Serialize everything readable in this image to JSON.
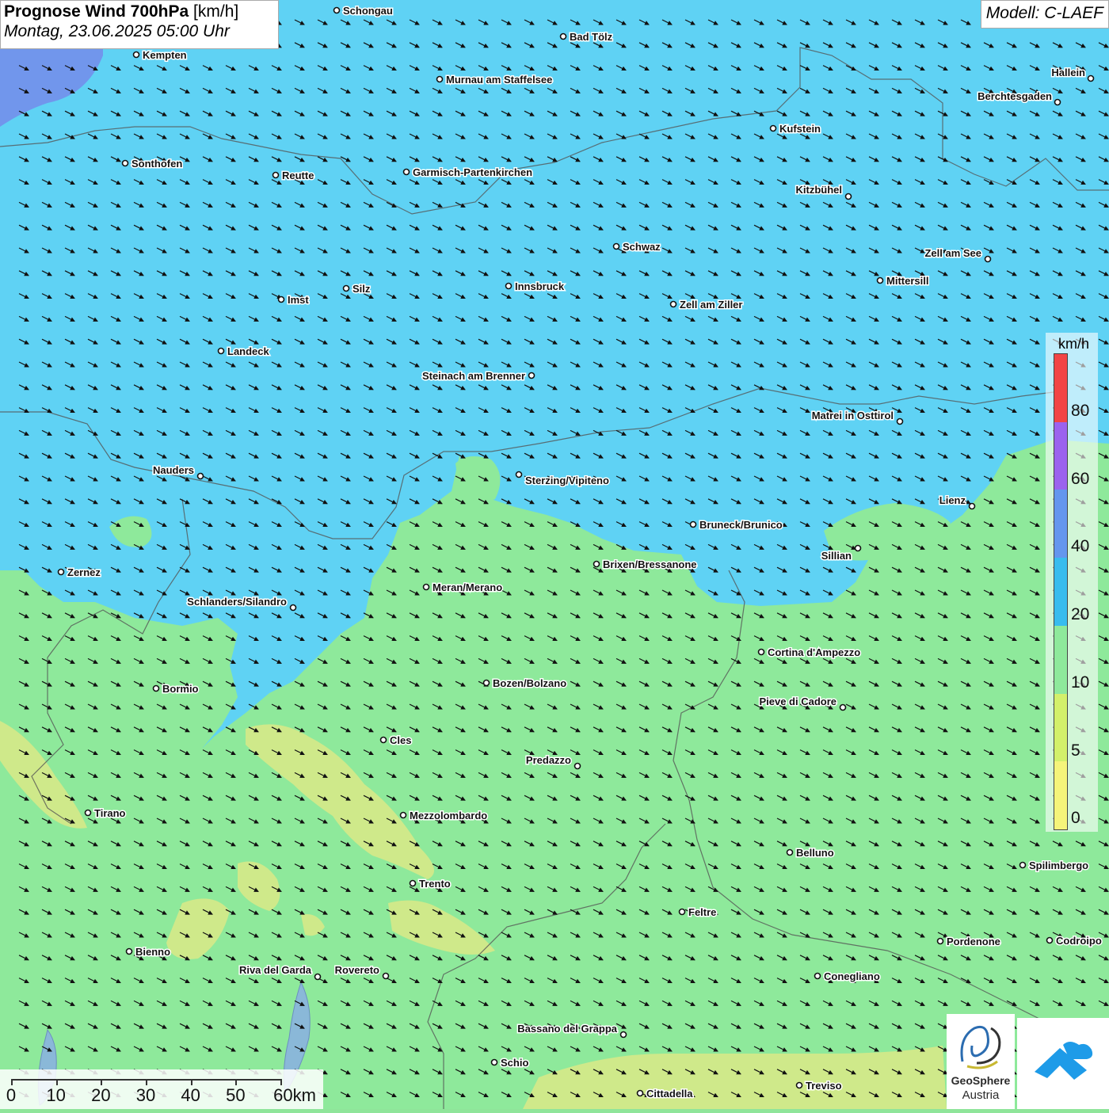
{
  "header": {
    "title_bold": "Prognose Wind 700hPa",
    "title_unit": "[km/h]",
    "datetime": "Montag, 23.06.2025 05:00 Uhr",
    "model": "Modell: C-LAEF"
  },
  "legend": {
    "unit": "km/h",
    "ticks": [
      "80",
      "60",
      "40",
      "20",
      "10",
      "5",
      "0"
    ],
    "colors": [
      "#f24545",
      "#9b62ee",
      "#6496ee",
      "#38bcee",
      "#8ee99b",
      "#d3f06a",
      "#f5f47a"
    ]
  },
  "scalebar": {
    "labels": [
      "0",
      "10",
      "20",
      "30",
      "40",
      "50",
      "60km"
    ]
  },
  "logos": {
    "geosphere_name": "GeoSphere",
    "geosphere_country": "Austria"
  },
  "colors": {
    "wind_10_20": "#8ee99b",
    "wind_20_40": "#5fd2f4",
    "wind_40_60": "#7196ec",
    "wind_5_10": "#cfe98a",
    "border": "#555555",
    "lake": "#8ab8d8",
    "arrow": "#111111"
  },
  "map": {
    "arrow_direction": "south-east",
    "cities": [
      {
        "name": "Schongau"
      },
      {
        "name": "Bad Tölz"
      },
      {
        "name": "Kempten"
      },
      {
        "name": "Murnau am Staffelsee"
      },
      {
        "name": "Hallein"
      },
      {
        "name": "Berchtesgaden"
      },
      {
        "name": "Kufstein"
      },
      {
        "name": "Sonthofen"
      },
      {
        "name": "Reutte"
      },
      {
        "name": "Garmisch-Partenkirchen"
      },
      {
        "name": "Kitzbühel"
      },
      {
        "name": "Schwaz"
      },
      {
        "name": "Zell am See"
      },
      {
        "name": "Innsbruck"
      },
      {
        "name": "Mittersill"
      },
      {
        "name": "Silz"
      },
      {
        "name": "Imst"
      },
      {
        "name": "Zell am Ziller"
      },
      {
        "name": "Landeck"
      },
      {
        "name": "Steinach am Brenner"
      },
      {
        "name": "Matrei in Osttirol"
      },
      {
        "name": "Nauders"
      },
      {
        "name": "Sterzing/Vipiteno"
      },
      {
        "name": "Lienz"
      },
      {
        "name": "Bruneck/Brunico"
      },
      {
        "name": "Sillian"
      },
      {
        "name": "Brixen/Bressanone"
      },
      {
        "name": "Zernez"
      },
      {
        "name": "Meran/Merano"
      },
      {
        "name": "Schlanders/Silandro"
      },
      {
        "name": "Cortina d'Ampezzo"
      },
      {
        "name": "Bozen/Bolzano"
      },
      {
        "name": "Bormio"
      },
      {
        "name": "Pieve di Cadore"
      },
      {
        "name": "Cles"
      },
      {
        "name": "Predazzo"
      },
      {
        "name": "Tirano"
      },
      {
        "name": "Mezzolombardo"
      },
      {
        "name": "Belluno"
      },
      {
        "name": "Spilimbergo"
      },
      {
        "name": "Trento"
      },
      {
        "name": "Feltre"
      },
      {
        "name": "Bienno"
      },
      {
        "name": "Pordenone"
      },
      {
        "name": "Codroipo"
      },
      {
        "name": "Riva del Garda"
      },
      {
        "name": "Rovereto"
      },
      {
        "name": "Conegliano"
      },
      {
        "name": "Bassano del Grappa"
      },
      {
        "name": "Schio"
      },
      {
        "name": "Cittadella"
      },
      {
        "name": "Treviso"
      }
    ]
  }
}
